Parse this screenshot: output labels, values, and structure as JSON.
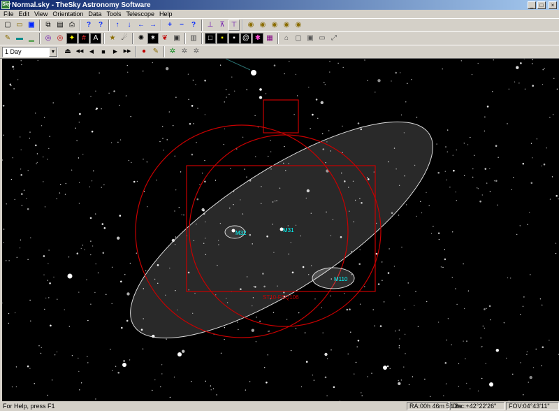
{
  "window": {
    "title": "Normal.sky - TheSky Astronomy Software",
    "icon_label": "Sky",
    "minimize": "_",
    "maximize": "□",
    "close": "×"
  },
  "menu": [
    "File",
    "Edit",
    "View",
    "Orientation",
    "Data",
    "Tools",
    "Telescope",
    "Help"
  ],
  "toolbar1": {
    "file": [
      "new-file-icon",
      "open-file-icon",
      "save-icon"
    ],
    "edit": [
      "copy-icon",
      "paste-icon",
      "print-icon"
    ],
    "help": [
      "help-icon",
      "context-help-icon"
    ],
    "nav": [
      {
        "icon": "arrow-up-icon",
        "glyph": "↑"
      },
      {
        "icon": "arrow-down-icon",
        "glyph": "↓"
      },
      {
        "icon": "arrow-left-icon",
        "glyph": "←"
      },
      {
        "icon": "arrow-right-icon",
        "glyph": "→"
      }
    ],
    "zoom": [
      {
        "icon": "zoom-in-icon",
        "glyph": "+"
      },
      {
        "icon": "zoom-out-icon",
        "glyph": "−"
      },
      {
        "icon": "find-icon",
        "glyph": "?"
      }
    ],
    "telescope": [
      "telescope-link-icon",
      "telescope-slew-icon",
      "telescope-center-icon"
    ],
    "coins": [
      "orbit-1-icon",
      "orbit-2-icon",
      "orbit-3-icon",
      "orbit-4-icon",
      "orbit-5-icon"
    ]
  },
  "toolbar2": {
    "set1": [
      "display-explorer-icon",
      "horizon-icon",
      "planets-icon",
      "deep-sky-icon",
      "constellation-icon",
      "grid-icon",
      "ground-icon",
      "labels-icon"
    ],
    "set2": [
      "stars-icon",
      "galaxies-icon",
      "nebulae-icon",
      "comets-icon"
    ],
    "set3": [
      "ccd-icon",
      "frame-black-icon",
      "frame-yellow-icon",
      "frame-white-icon",
      "frame-spiral-icon",
      "frame-pink-icon"
    ],
    "set4": [
      "camera-icon",
      "image-icon",
      "reticle-icon",
      "focus-icon",
      "tools-icon"
    ]
  },
  "toolbar3": {
    "time_step": "1 Day",
    "playback": [
      {
        "icon": "rewind-icon",
        "glyph": "⏏"
      },
      {
        "icon": "skip-back-icon",
        "glyph": "◀◀"
      },
      {
        "icon": "step-back-icon",
        "glyph": "◀"
      },
      {
        "icon": "stop-icon",
        "glyph": "■"
      },
      {
        "icon": "step-forward-icon",
        "glyph": "▶"
      },
      {
        "icon": "skip-forward-icon",
        "glyph": "▶▶"
      }
    ],
    "record": [
      {
        "icon": "record-icon",
        "glyph": "●"
      },
      {
        "icon": "pencil-icon",
        "glyph": "✎"
      }
    ],
    "extra": [
      "sky-chart-icon",
      "export-chart-icon",
      "print-chart-icon"
    ]
  },
  "sky": {
    "objects": [
      {
        "id": "m32",
        "label": "M32"
      },
      {
        "id": "m31",
        "label": "M31"
      },
      {
        "id": "m110",
        "label": "M110"
      }
    ],
    "ccd_frame_label": "ST10-FSQ106",
    "colors": {
      "background": "#000000",
      "fov": "#cc0000",
      "label": "#00ffff",
      "galaxy": "#ffffff"
    }
  },
  "status": {
    "help": "For Help, press F1",
    "ra": "RA:00h 46m 54.8s",
    "dec": "Dec:+42°22'26\"",
    "fov": "FOV:04°43'11\""
  }
}
